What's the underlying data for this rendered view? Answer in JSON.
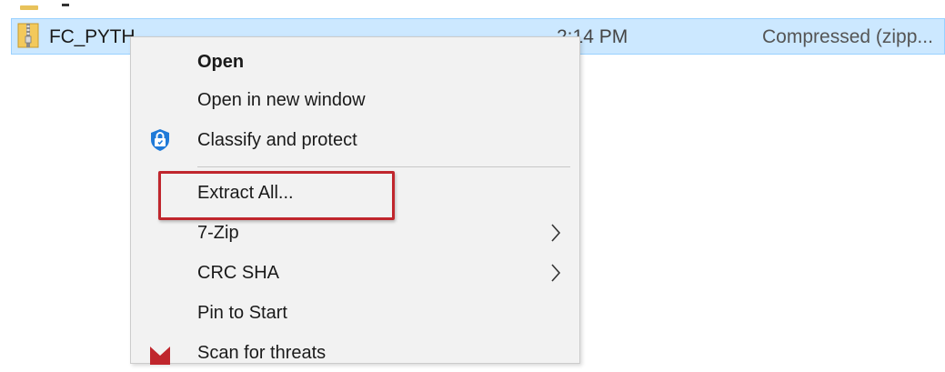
{
  "file": {
    "name": "FC_PYTH",
    "date_modified": "2:14 PM",
    "type": "Compressed (zipp...",
    "icon": "zip-folder-icon"
  },
  "context_menu": {
    "items": [
      {
        "label": "Open",
        "bold": true
      },
      {
        "label": "Open in new window"
      },
      {
        "label": "Classify and protect",
        "icon": "shield-lock-icon"
      },
      {
        "label": "Extract All...",
        "highlighted": true
      },
      {
        "label": "7-Zip",
        "has_submenu": true
      },
      {
        "label": "CRC SHA",
        "has_submenu": true
      },
      {
        "label": "Pin to Start"
      },
      {
        "label": "Scan for threats",
        "icon": "scan-icon",
        "partially_visible": true
      }
    ]
  },
  "highlight_color": "#c0262d",
  "selection_color": "#cce8ff"
}
